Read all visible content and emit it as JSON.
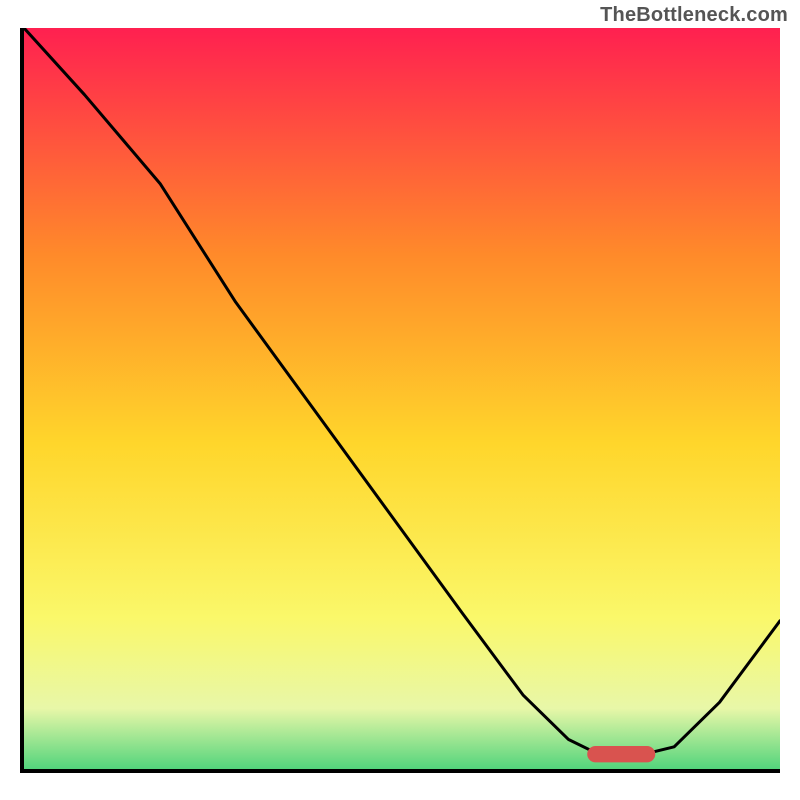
{
  "watermark": "TheBottleneck.com",
  "colors": {
    "top": "#ff2050",
    "upper_mid": "#ff8a2a",
    "mid": "#ffd62b",
    "lower_mid": "#faf86a",
    "pale": "#e8f7a8",
    "bottom": "#2ecc71",
    "curve": "#000000",
    "marker": "#d9534f",
    "axes": "#000000"
  },
  "chart_data": {
    "type": "line",
    "title": "",
    "xlabel": "",
    "ylabel": "",
    "xlim": [
      0,
      100
    ],
    "ylim": [
      0,
      100
    ],
    "grid": false,
    "series": [
      {
        "name": "bottleneck-curve",
        "x": [
          0,
          8,
          18,
          28,
          38,
          48,
          58,
          66,
          72,
          76,
          82,
          86,
          92,
          100
        ],
        "values": [
          100,
          91,
          79,
          63,
          49,
          35,
          21,
          10,
          4,
          2,
          2,
          3,
          9,
          20
        ]
      }
    ],
    "annotations": [
      {
        "name": "optimal-range-marker",
        "x_start": 75,
        "x_end": 83,
        "y": 2
      }
    ],
    "gradient_stops": [
      {
        "offset": 0,
        "meaning": "severe-bottleneck",
        "color_key": "top"
      },
      {
        "offset": 30,
        "meaning": "high-bottleneck",
        "color_key": "upper_mid"
      },
      {
        "offset": 55,
        "meaning": "moderate",
        "color_key": "mid"
      },
      {
        "offset": 78,
        "meaning": "mild",
        "color_key": "lower_mid"
      },
      {
        "offset": 90,
        "meaning": "near-optimal",
        "color_key": "pale"
      },
      {
        "offset": 100,
        "meaning": "optimal",
        "color_key": "bottom"
      }
    ]
  }
}
